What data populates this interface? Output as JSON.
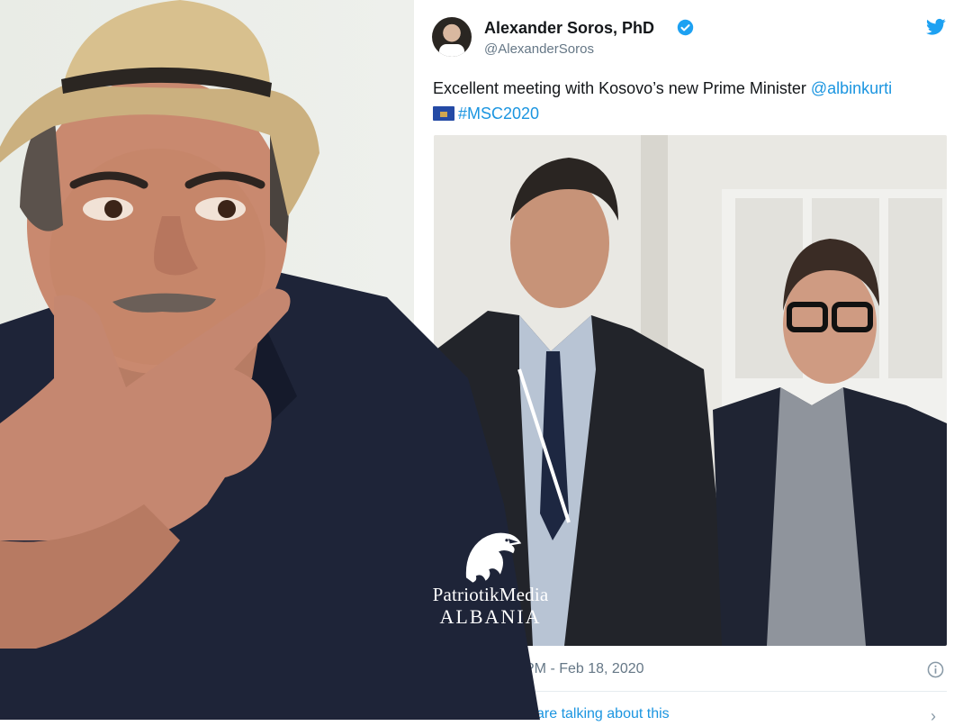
{
  "tweet": {
    "display_name": "Alexander Soros, PhD",
    "handle": "@AlexanderSoros",
    "text_before": "Excellent meeting with Kosovo’s new Prime Minister ",
    "mention": "@albinkurti",
    "hashtag": "#MSC2020",
    "timestamp": "PM - Feb 18, 2020",
    "talking_link": "are talking about this",
    "icons": [
      "verified-badge-icon",
      "twitter-bird-icon",
      "info-icon",
      "chevron-right-icon",
      "kosovo-flag-icon"
    ],
    "colors": {
      "link": "#1b95e0",
      "text": "#14171a",
      "muted": "#657786"
    }
  },
  "watermark": {
    "line1": "PatriotikMedia",
    "line2": "ALBANIA"
  }
}
